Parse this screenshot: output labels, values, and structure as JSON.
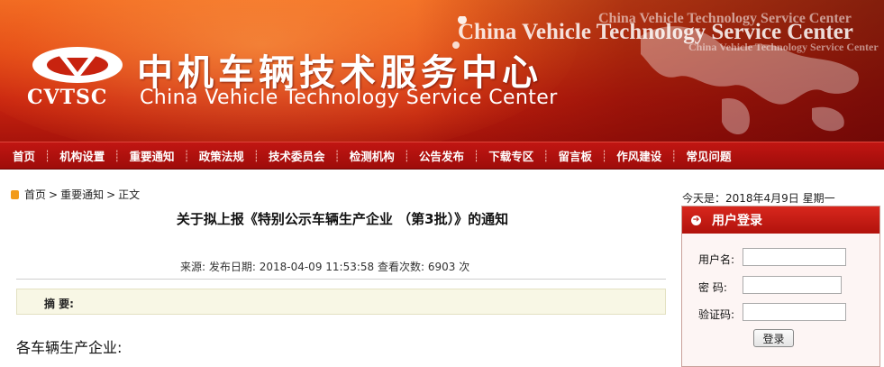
{
  "header": {
    "logo_text": "CVTSC",
    "title_cn": "中机车辆技术服务中心",
    "title_en": "China Vehicle Technology Service Center",
    "watermark_large": "China Vehicle Technology Service Center",
    "watermark_small_1": "China Vehicle Technology Service Center",
    "watermark_small_2": "China Vehicle Technology Service Center"
  },
  "nav": {
    "items": [
      "首页",
      "机构设置",
      "重要通知",
      "政策法规",
      "技术委员会",
      "检测机构",
      "公告发布",
      "下载专区",
      "留言板",
      "作风建设",
      "常见问题"
    ],
    "separator": "┊"
  },
  "breadcrumb": {
    "home": "首页",
    "sep1": ">",
    "section": "重要通知",
    "sep2": ">",
    "current": "正文"
  },
  "today": "今天是：2018年4月9日 星期一",
  "article": {
    "title": "关于拟上报《特别公示车辆生产企业 （第3批）》的通知",
    "meta": "来源:   发布日期: 2018-04-09 11:53:58   查看次数: 6903 次",
    "summary_label": "摘 要:",
    "body_start": "各车辆生产企业:"
  },
  "login": {
    "title": "用户登录",
    "username_label": "用户名:",
    "password_label": "密   码:",
    "captcha_label": "验证码:",
    "submit": "登录",
    "username_value": "",
    "password_value": "",
    "captcha_value": ""
  },
  "icons": {
    "breadcrumb": "home-icon",
    "login_header": "arrow-circle-icon"
  },
  "colors": {
    "banner_red": "#c8230f",
    "nav_red": "#9e0c0a",
    "summary_bg": "#f8f7e5",
    "login_bg": "#fdf5f4"
  }
}
